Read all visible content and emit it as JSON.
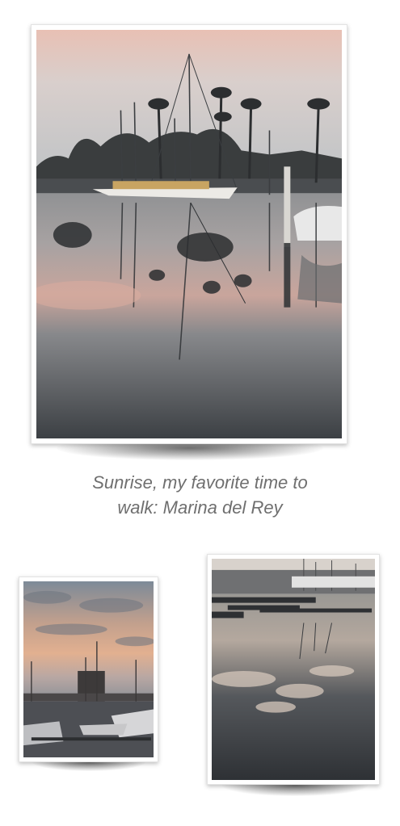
{
  "caption": {
    "line1": "Sunrise, my favorite time to",
    "line2": "walk: Marina del Rey"
  },
  "photos": [
    {
      "subject": "sailboats-and-palm-trees-reflected-in-marina-at-sunrise"
    },
    {
      "subject": "sunset-sky-over-marina-with-building-and-masts"
    },
    {
      "subject": "docks-with-clouds-reflected-in-still-water"
    }
  ],
  "colors": {
    "background": "#ffffff",
    "caption": "#6f6f6f",
    "sky_pink": "#e9c4b7",
    "sky_grey": "#c3c8cd",
    "water_dark": "#3f4347"
  }
}
